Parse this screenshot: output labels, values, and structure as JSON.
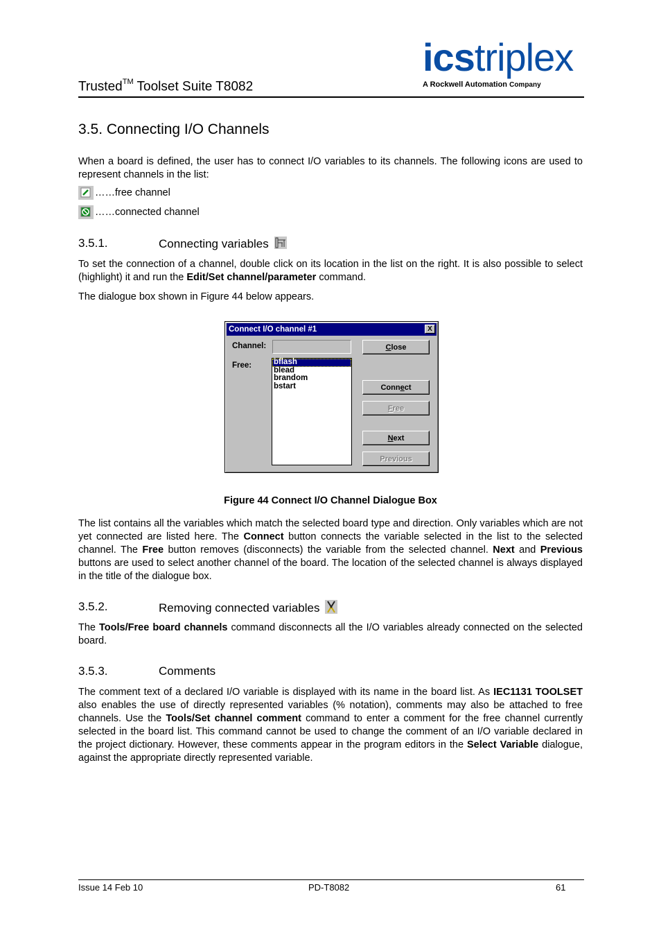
{
  "header": {
    "title_main": "Trusted",
    "title_sup": "TM",
    "title_rest": " Toolset Suite T8082",
    "logo": {
      "ics": "ics",
      "triplex": "triplex",
      "tagline": "A Rockwell Automation",
      "tagline_company": "Company"
    }
  },
  "section": {
    "title": "3.5. Connecting I/O Channels",
    "intro": "When a board is defined, the user has to connect I/O variables to its channels. The following icons are used to represent channels in the list:",
    "icon_legend": [
      {
        "icon": "free-channel-icon",
        "label": "……free channel"
      },
      {
        "icon": "connected-channel-icon",
        "label": "……connected channel"
      }
    ]
  },
  "sub1": {
    "number": "3.5.1.",
    "title": "Connecting variables",
    "icon": "connect-variables-icon",
    "p1_a": "To set the connection of a channel, double click on its location in the list on the right.  It is also possible to select (highlight) it and run the ",
    "p1_b": "Edit/Set channel/parameter",
    "p1_c": " command.",
    "p2": "The dialogue box shown in Figure 44 below appears."
  },
  "dialog": {
    "title": "Connect I/O channel #1",
    "close_glyph": "X",
    "channel_label": "Channel:",
    "channel_value": "",
    "free_label": "Free:",
    "free_list": [
      "bflash",
      "blead",
      "brandom",
      "bstart"
    ],
    "selected_index": 0,
    "buttons": {
      "close": {
        "pre": "",
        "u": "C",
        "post": "lose",
        "enabled": true
      },
      "connect": {
        "pre": "Conn",
        "u": "e",
        "post": "ct",
        "enabled": true
      },
      "free": {
        "pre": "",
        "u": "F",
        "post": "ree",
        "enabled": false
      },
      "next": {
        "pre": "",
        "u": "N",
        "post": "ext",
        "enabled": true
      },
      "previous": {
        "pre": "",
        "u": "P",
        "post": "revious",
        "enabled": false
      }
    }
  },
  "figure_caption": "Figure 44 Connect I/O Channel Dialogue Box",
  "p_list": {
    "a": "The list contains all the variables which match the selected board type and direction.  Only variables which are not yet connected are listed here.  The ",
    "b": "Connect",
    "c": " button connects the variable selected in the list to the selected channel. The ",
    "d": "Free",
    "e": " button removes (disconnects) the variable from the selected channel. ",
    "f": "Next",
    "g": " and ",
    "h": "Previous",
    "i": " buttons are used to select another channel of the board.  The location of the selected channel is always displayed in the title of the dialogue box."
  },
  "sub2": {
    "number": "3.5.2.",
    "title": "Removing connected variables",
    "icon": "free-board-channels-icon",
    "p_a": "The ",
    "p_b": "Tools/Free board channels",
    "p_c": " command disconnects all the I/O variables already connected on the selected board."
  },
  "sub3": {
    "number": "3.5.3.",
    "title": "Comments",
    "p_a": "The comment text of a declared I/O variable is displayed with its name in the board  list.  As ",
    "p_b": "IEC1131 TOOLSET",
    "p_c": " also enables the use of directly represented variables (% notation), comments may also be attached to free channels.  Use the ",
    "p_d": "Tools/Set channel comment",
    "p_e": " command to enter a comment for the free channel currently selected in the board list.  This command cannot be used to change the comment of an I/O variable declared in the project dictionary. However, these comments appear in the program editors in the ",
    "p_f": "Select Variable",
    "p_g": " dialogue, against the appropriate directly represented variable."
  },
  "footer": {
    "issue": "Issue 14 Feb 10",
    "doc_id": "PD-T8082",
    "page": "61"
  }
}
